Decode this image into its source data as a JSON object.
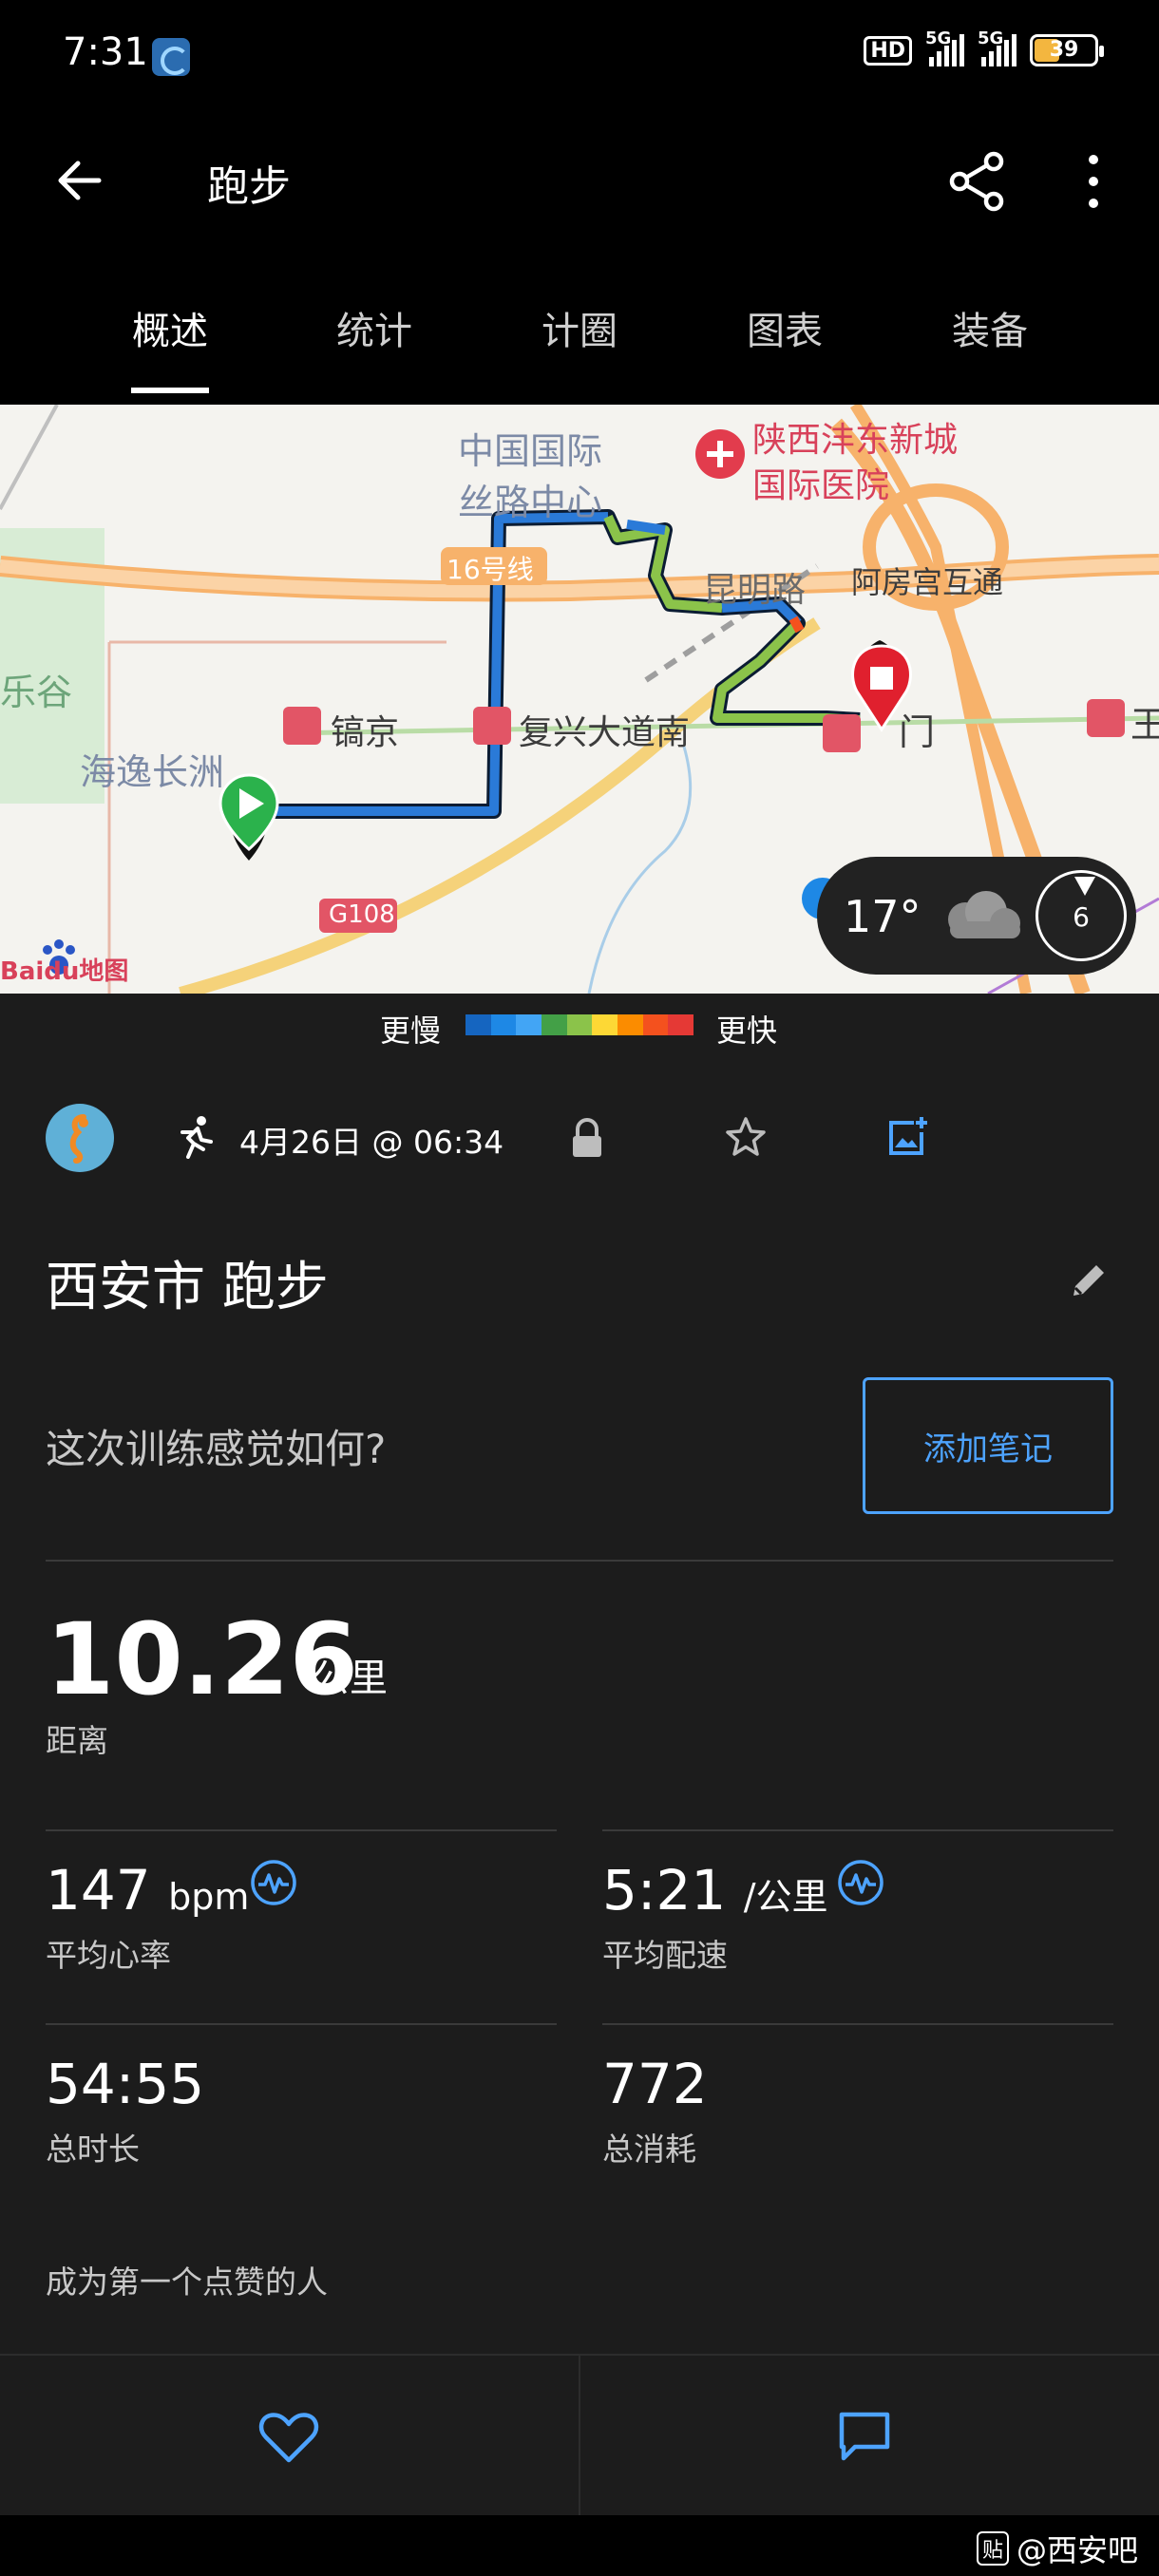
{
  "status_bar": {
    "time": "7:31",
    "hd": "HD",
    "signal1": "5G",
    "signal2": "5G",
    "battery": "39"
  },
  "header": {
    "title": "跑步",
    "icons": [
      "back-arrow-icon",
      "share-icon",
      "more-vertical-icon"
    ]
  },
  "tabs": [
    {
      "label": "概述",
      "active": true
    },
    {
      "label": "统计",
      "active": false
    },
    {
      "label": "计圈",
      "active": false
    },
    {
      "label": "图表",
      "active": false
    },
    {
      "label": "装备",
      "active": false
    }
  ],
  "map": {
    "labels": {
      "zhongguo": "中国国际",
      "silu": "丝路中心",
      "hospital1": "陕西沣东新城",
      "hospital2": "国际医院",
      "line16": "16号线",
      "kunming": "昆明路",
      "afang": "阿房宫互通",
      "legu": "乐谷",
      "gaojing": "镐京",
      "fuxing": "复兴大道南",
      "haiyi": "海逸长洲",
      "g108": "G108",
      "station_right": "王",
      "station_end": "门",
      "baidu": "Baidu地图"
    },
    "weather": {
      "temp": "17°",
      "wind": "6"
    }
  },
  "pace_legend": {
    "slow": "更慢",
    "fast": "更快",
    "colors": [
      "#1565c0",
      "#1e88e5",
      "#42a5f5",
      "#43a047",
      "#8bc34a",
      "#fdd835",
      "#fb8c00",
      "#f4511e",
      "#e53935"
    ]
  },
  "activity": {
    "date": "4月26日 @ 06:34",
    "title": "西安市 跑步",
    "feel_prompt": "这次训练感觉如何?",
    "add_note": "添加笔记"
  },
  "stats": {
    "distance": {
      "value": "10.26",
      "unit": "公里",
      "label": "距离"
    },
    "heart_rate": {
      "value": "147",
      "unit": "bpm",
      "label": "平均心率"
    },
    "pace": {
      "value": "5:21",
      "unit": "/公里",
      "label": "平均配速"
    },
    "duration": {
      "value": "54:55",
      "label": "总时长"
    },
    "calories": {
      "value": "772",
      "label": "总消耗"
    }
  },
  "likes_text": "成为第一个点赞的人",
  "watermark": {
    "badge": "贴",
    "text": "@西安吧"
  },
  "accent_color": "#4da3ff"
}
